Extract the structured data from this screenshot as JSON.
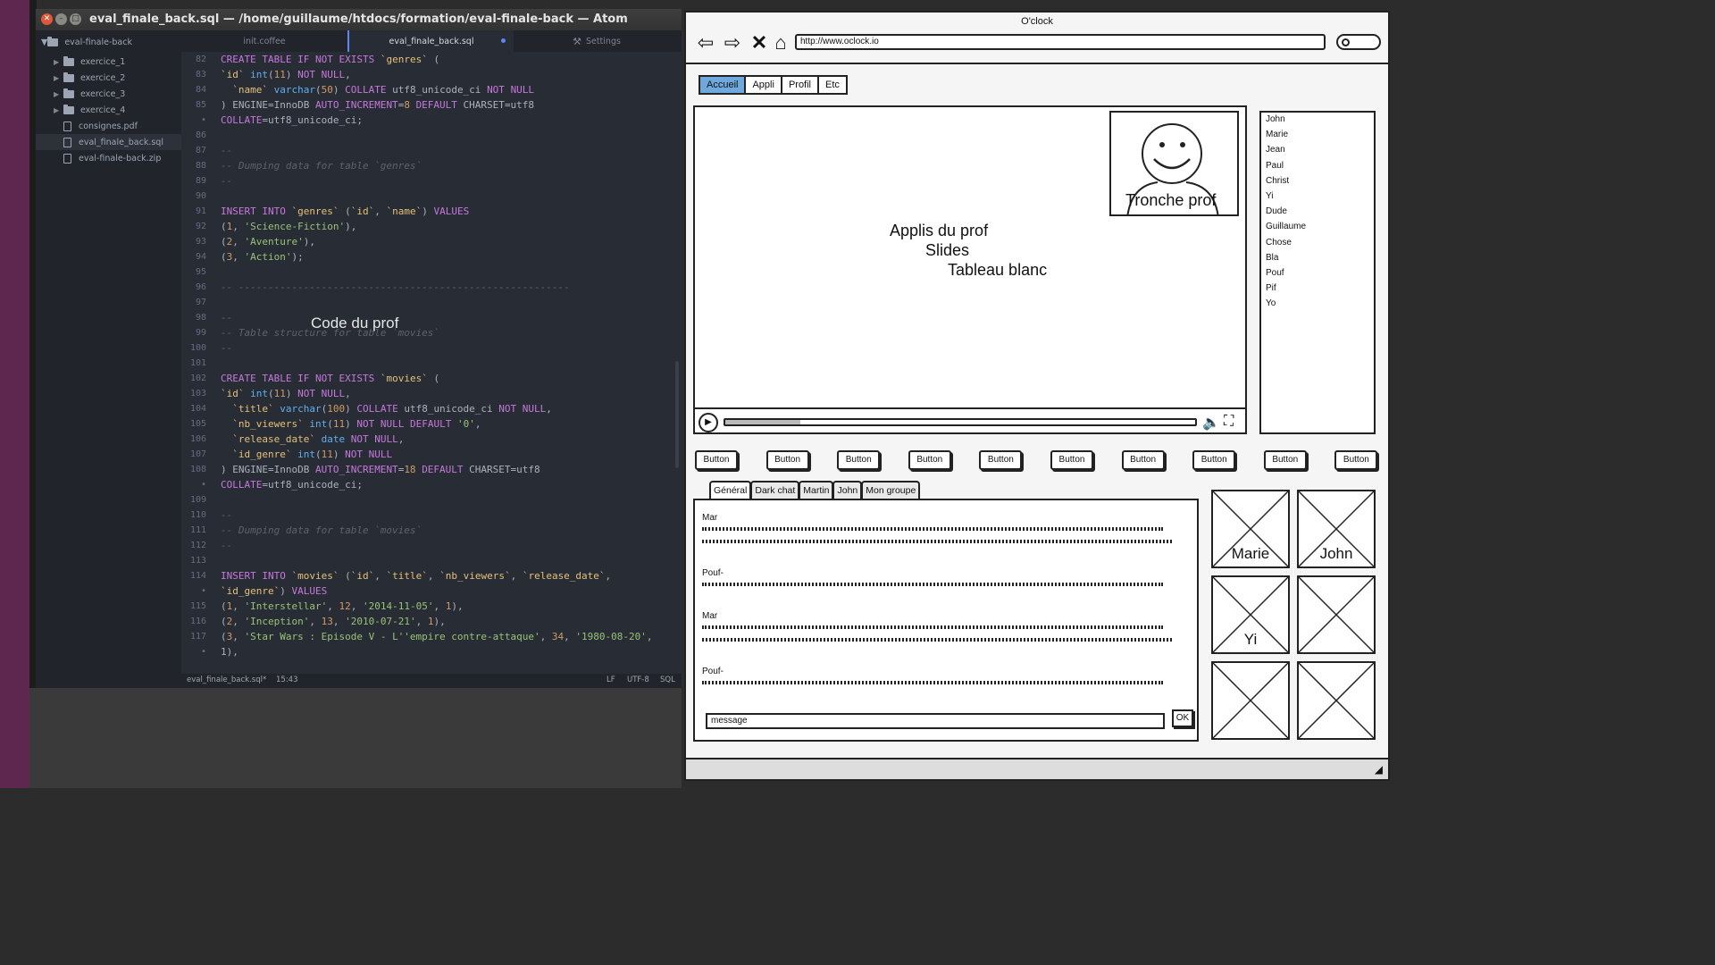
{
  "atom": {
    "title": "eval_finale_back.sql — /home/guillaume/htdocs/formation/eval-finale-back — Atom",
    "tree_root": "eval-finale-back",
    "tree_items": [
      {
        "label": "exercice_1",
        "kind": "folder"
      },
      {
        "label": "exercice_2",
        "kind": "folder"
      },
      {
        "label": "exercice_3",
        "kind": "folder"
      },
      {
        "label": "exercice_4",
        "kind": "folder"
      },
      {
        "label": "consignes.pdf",
        "kind": "file"
      },
      {
        "label": "eval_finale_back.sql",
        "kind": "file",
        "selected": true
      },
      {
        "label": "eval-finale-back.zip",
        "kind": "file"
      }
    ],
    "tabs": [
      {
        "label": "init.coffee"
      },
      {
        "label": "eval_finale_back.sql",
        "active": true,
        "modified": true
      },
      {
        "label": "Settings"
      }
    ],
    "code_overlay": "Code du prof",
    "status": {
      "file": "eval_finale_back.sql*",
      "cursor": "15:43",
      "eol": "LF",
      "encoding": "UTF-8",
      "grammar": "SQL"
    },
    "lines": [
      {
        "n": "82",
        "text": "CREATE TABLE IF NOT EXISTS `genres` ("
      },
      {
        "n": "83",
        "text": "`id` int(11) NOT NULL,"
      },
      {
        "n": "84",
        "text": "  `name` varchar(50) COLLATE utf8_unicode_ci NOT NULL"
      },
      {
        "n": "85",
        "text": ") ENGINE=InnoDB AUTO_INCREMENT=8 DEFAULT CHARSET=utf8"
      },
      {
        "n": "•",
        "text": "COLLATE=utf8_unicode_ci;"
      },
      {
        "n": "86",
        "text": ""
      },
      {
        "n": "87",
        "text": "--"
      },
      {
        "n": "88",
        "text": "-- Dumping data for table `genres`"
      },
      {
        "n": "89",
        "text": "--"
      },
      {
        "n": "90",
        "text": ""
      },
      {
        "n": "91",
        "text": "INSERT INTO `genres` (`id`, `name`) VALUES"
      },
      {
        "n": "92",
        "text": "(1, 'Science-Fiction'),"
      },
      {
        "n": "93",
        "text": "(2, 'Aventure'),"
      },
      {
        "n": "94",
        "text": "(3, 'Action');"
      },
      {
        "n": "95",
        "text": ""
      },
      {
        "n": "96",
        "text": "-- --------------------------------------------------------"
      },
      {
        "n": "97",
        "text": ""
      },
      {
        "n": "98",
        "text": "--"
      },
      {
        "n": "99",
        "text": "-- Table structure for table `movies`"
      },
      {
        "n": "100",
        "text": "--"
      },
      {
        "n": "101",
        "text": ""
      },
      {
        "n": "102",
        "text": "CREATE TABLE IF NOT EXISTS `movies` ("
      },
      {
        "n": "103",
        "text": "`id` int(11) NOT NULL,"
      },
      {
        "n": "104",
        "text": "  `title` varchar(100) COLLATE utf8_unicode_ci NOT NULL,"
      },
      {
        "n": "105",
        "text": "  `nb_viewers` int(11) NOT NULL DEFAULT '0',"
      },
      {
        "n": "106",
        "text": "  `release_date` date NOT NULL,"
      },
      {
        "n": "107",
        "text": "  `id_genre` int(11) NOT NULL"
      },
      {
        "n": "108",
        "text": ") ENGINE=InnoDB AUTO_INCREMENT=18 DEFAULT CHARSET=utf8"
      },
      {
        "n": "•",
        "text": "COLLATE=utf8_unicode_ci;"
      },
      {
        "n": "109",
        "text": ""
      },
      {
        "n": "110",
        "text": "--"
      },
      {
        "n": "111",
        "text": "-- Dumping data for table `movies`"
      },
      {
        "n": "112",
        "text": "--"
      },
      {
        "n": "113",
        "text": ""
      },
      {
        "n": "114",
        "text": "INSERT INTO `movies` (`id`, `title`, `nb_viewers`, `release_date`,"
      },
      {
        "n": "•",
        "text": "`id_genre`) VALUES"
      },
      {
        "n": "115",
        "text": "(1, 'Interstellar', 12, '2014-11-05', 1),"
      },
      {
        "n": "116",
        "text": "(2, 'Inception', 13, '2010-07-21', 1),"
      },
      {
        "n": "117",
        "text": "(3, 'Star Wars : Episode V - L''empire contre-attaque', 34, '1980-08-20',"
      },
      {
        "n": "•",
        "text": "1),"
      }
    ]
  },
  "mockup": {
    "window_title": "O'clock",
    "url": "http://www.oclock.io",
    "nav_tabs": [
      "Accueil",
      "Appli",
      "Profil",
      "Etc"
    ],
    "active_nav_tab": "Accueil",
    "video": {
      "lines": [
        "Applis du prof",
        "Slides",
        "Tableau blanc"
      ],
      "webcam_label": "Tronche prof",
      "progress": 0.16
    },
    "users": [
      "John",
      "Marie",
      "Jean",
      "Paul",
      "Christ",
      "Yi",
      "Dude",
      "Guillaume",
      "Chose",
      "Bla",
      "Pouf",
      "Pif",
      "Yo"
    ],
    "buttons": [
      "Button",
      "Button",
      "Button",
      "Button",
      "Button",
      "Button",
      "Button",
      "Button",
      "Button",
      "Button"
    ],
    "chat_tabs": [
      "Général",
      "Dark chat",
      "Martin",
      "John",
      "Mon groupe"
    ],
    "messages": [
      {
        "author": "Mar",
        "lines": 2
      },
      {
        "author": "Pouf-",
        "lines": 1
      },
      {
        "author": "Mar",
        "lines": 2
      },
      {
        "author": "Pouf-",
        "lines": 1
      }
    ],
    "message_input": "message",
    "ok_label": "OK",
    "video_tiles": [
      "Marie",
      "John",
      "Yi",
      "",
      "",
      ""
    ]
  }
}
